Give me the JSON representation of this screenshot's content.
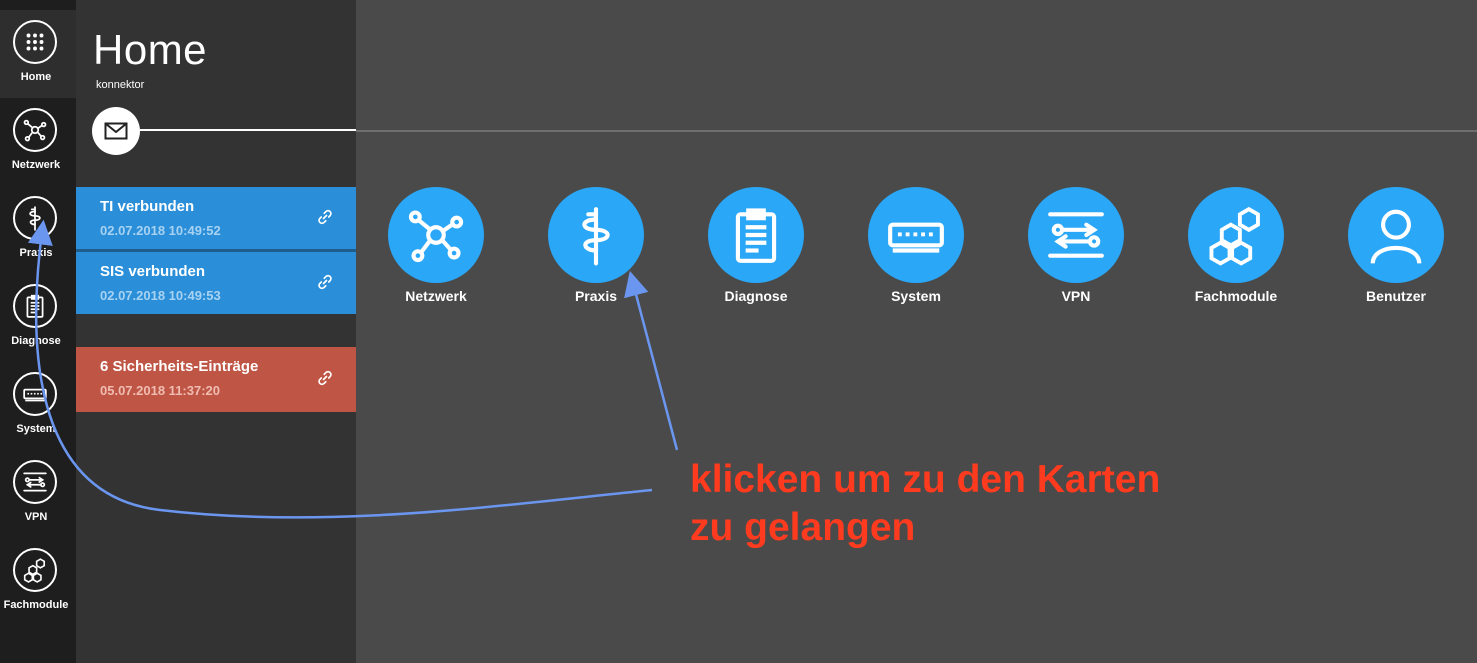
{
  "rail": {
    "items": [
      {
        "label": "Home",
        "icon": "grid-icon",
        "active": true
      },
      {
        "label": "Netzwerk",
        "icon": "network-icon"
      },
      {
        "label": "Praxis",
        "icon": "caduceus-icon"
      },
      {
        "label": "Diagnose",
        "icon": "clipboard-icon"
      },
      {
        "label": "System",
        "icon": "device-icon"
      },
      {
        "label": "VPN",
        "icon": "vpn-icon"
      },
      {
        "label": "Fachmodule",
        "icon": "hexagons-icon"
      }
    ]
  },
  "panel": {
    "title": "Home",
    "subtitle": "konnektor",
    "mail_icon": "envelope-icon",
    "cards": [
      {
        "title": "TI verbunden",
        "time": "02.07.2018 10:49:52",
        "status": "blue"
      },
      {
        "title": "SIS verbunden",
        "time": "02.07.2018 10:49:53",
        "status": "blue"
      },
      {
        "title": "6 Sicherheits-Einträge",
        "time": "05.07.2018 11:37:20",
        "status": "red"
      }
    ]
  },
  "tiles": [
    {
      "label": "Netzwerk",
      "icon": "network-icon"
    },
    {
      "label": "Praxis",
      "icon": "caduceus-icon"
    },
    {
      "label": "Diagnose",
      "icon": "clipboard-icon"
    },
    {
      "label": "System",
      "icon": "device-icon"
    },
    {
      "label": "VPN",
      "icon": "vpn-icon"
    },
    {
      "label": "Fachmodule",
      "icon": "hexagons-icon"
    },
    {
      "label": "Benutzer",
      "icon": "user-icon"
    }
  ],
  "annotation": {
    "line1": "klicken um zu den Karten",
    "line2": "zu gelangen"
  },
  "colors": {
    "accent": "#2ba7f7",
    "card_blue": "#2a8fd8",
    "card_red": "#bf5645",
    "annotation_text": "#ff3b1f",
    "annotation_arrow": "#6b96f0"
  }
}
